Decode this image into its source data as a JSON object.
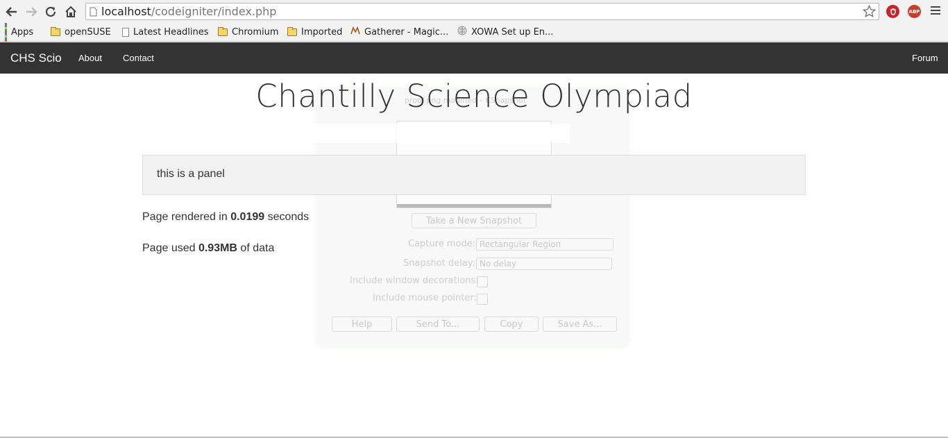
{
  "browser": {
    "url_host": "localhost",
    "url_path": "/codeigniter/index.php",
    "extensions": {
      "abp_label": "ABP"
    }
  },
  "bookmarks": [
    {
      "label": "Apps",
      "icon": "apps-grid-icon"
    },
    {
      "label": "openSUSE",
      "icon": "folder-icon"
    },
    {
      "label": "Latest Headlines",
      "icon": "page-icon"
    },
    {
      "label": "Chromium",
      "icon": "folder-icon"
    },
    {
      "label": "Imported",
      "icon": "folder-icon"
    },
    {
      "label": "Gatherer - Magic...",
      "icon": "gatherer-icon"
    },
    {
      "label": "XOWA Set up En...",
      "icon": "xowa-icon"
    }
  ],
  "navbar": {
    "brand": "CHS Scio",
    "links": [
      "About",
      "Contact"
    ],
    "right_link": "Forum"
  },
  "main": {
    "title": "Chantilly Science Olympiad",
    "panel_text": "this is a panel",
    "render": {
      "prefix": "Page rendered in ",
      "value": "0.0199",
      "suffix": " seconds"
    },
    "memory": {
      "prefix": "Page used ",
      "value": "0.93MB",
      "suffix": " of data"
    }
  },
  "ghost_overlay": {
    "window_title": "proof.png modified – KSnapshot",
    "new_snapshot": "Take a New Snapshot",
    "capture_mode_label": "Capture mode:",
    "capture_mode_value": "Rectangular Region",
    "delay_label": "Snapshot delay:",
    "delay_value": "No delay",
    "decorations_label": "Include window decorations:",
    "pointer_label": "Include mouse pointer:",
    "buttons": [
      "Help",
      "Send To...",
      "Copy",
      "Save As..."
    ]
  },
  "colors": {
    "navbar_bg": "#333333",
    "panel_bg": "#f1f1f1",
    "chrome_bg": "#f2f2f2"
  }
}
